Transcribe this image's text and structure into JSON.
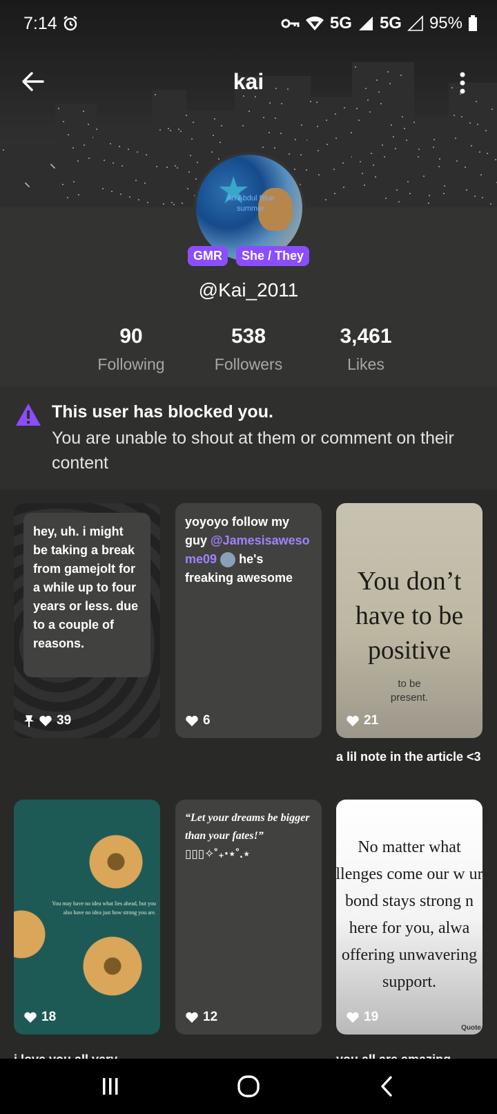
{
  "status": {
    "time": "7:14",
    "network1": "5G",
    "network2": "5G",
    "battery": "95%"
  },
  "header": {
    "title": "kai"
  },
  "profile": {
    "avatar_text": "Ari Abdul Blue summer",
    "badges": [
      "GMR",
      "She / They"
    ],
    "username": "@Kai_2011",
    "stats": [
      {
        "value": "90",
        "label": "Following"
      },
      {
        "value": "538",
        "label": "Followers"
      },
      {
        "value": "3,461",
        "label": "Likes"
      }
    ]
  },
  "blocked": {
    "title": "This user has blocked you.",
    "message": "You are unable to shout at them or comment on their content"
  },
  "posts": [
    {
      "text": "hey, uh. i might be taking a break from gamejolt for a while up to four years or less. due to a couple of reasons.",
      "likes": "39",
      "pinned": true
    },
    {
      "text": "yoyoyo follow my guy",
      "mention": "@Jamesisawesome09",
      "text_after": "he's freaking awesome",
      "likes": "6"
    },
    {
      "quote_big": "You don’t have to be positive",
      "quote_small": "to be present.",
      "likes": "21",
      "caption": "a lil note in the article <3"
    },
    {
      "flower_text": "You may have no idea what lies ahead, but you also have no idea just how strong you are.",
      "likes": "18",
      "caption": "i love you all very"
    },
    {
      "script_text": "“Let your dreams be bigger than your fates!”",
      "symbols": "▯▯▯✧˚₊‧⋆˚.⋆",
      "likes": "12"
    },
    {
      "quote_big": "No matter what llenges come our w ur bond stays strong n here for you, alwa offering unwavering support.",
      "badge": "Quote",
      "likes": "19",
      "caption": "you all are amazing,"
    }
  ],
  "colors": {
    "accent": "#8a4dff",
    "background": "#2b2b29",
    "card": "#414140"
  }
}
